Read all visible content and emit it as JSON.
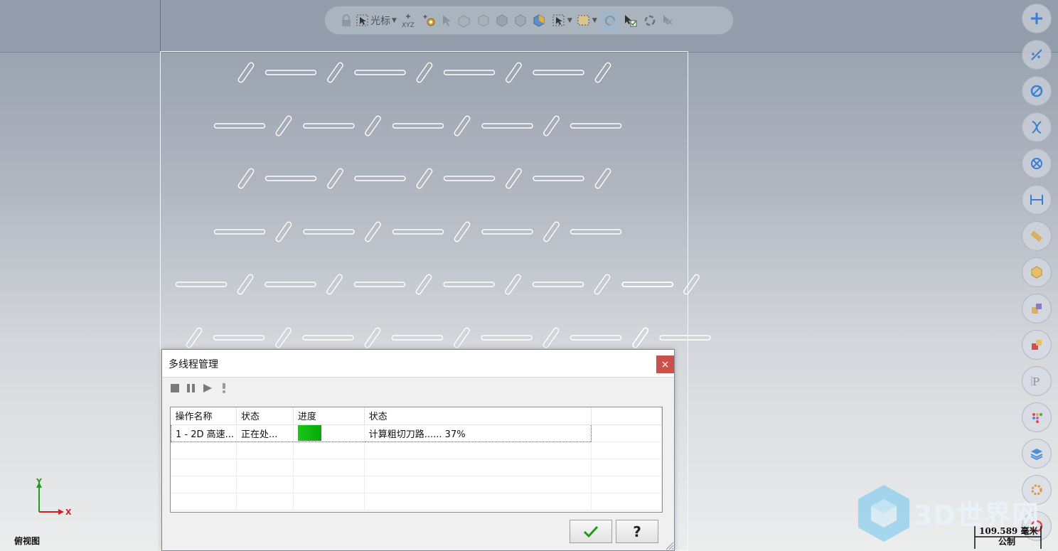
{
  "toolbar": {
    "cursor_label": "光标",
    "xyz_label": "XYZ"
  },
  "dialog": {
    "title": "多线程管理",
    "close_glyph": "×",
    "columns": [
      "操作名称",
      "状态",
      "进度",
      "状态"
    ],
    "rows": [
      {
        "name": "1 - 2D 高速...",
        "state": "正在处...",
        "progress_percent": 37,
        "status": "计算粗切刀路...... 37%"
      }
    ],
    "empty_rows": 4,
    "help_label": "?"
  },
  "viewport": {
    "view_label": "俯视图",
    "axis_x": "X",
    "axis_y": "Y",
    "scale_value": "109.589 毫米",
    "scale_unit": "公制",
    "watermark": "3D世界网"
  },
  "colors": {
    "progress_green": "#18c818",
    "close_red": "#c9514c",
    "axis_x": "#cc2222",
    "axis_y": "#1e9e1e"
  },
  "right_toolbar_icons": [
    "plus-icon",
    "line-icon",
    "circle-icon",
    "curve-icon",
    "circle-cross-icon",
    "dimension-icon",
    "ruler-icon",
    "box-icon",
    "layer-color-icon",
    "layer-red-icon",
    "text-icon",
    "palette-icon",
    "layers-icon",
    "gear-icon",
    "record-icon"
  ]
}
